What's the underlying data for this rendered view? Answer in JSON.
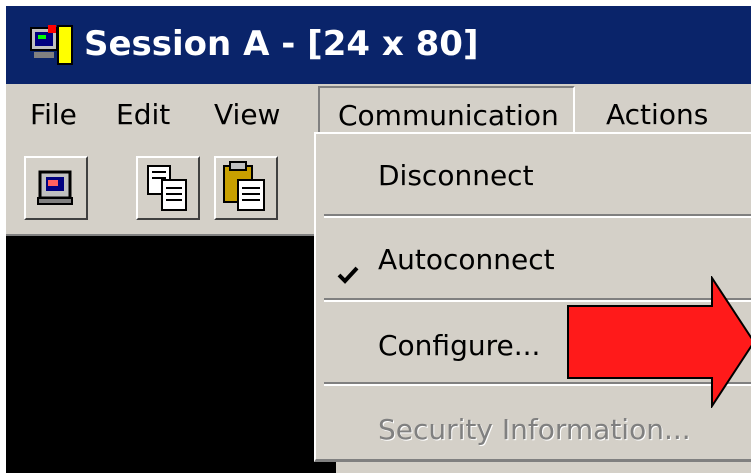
{
  "window": {
    "title": "Session A - [24 x 80]"
  },
  "menubar": {
    "items": [
      {
        "label": "File"
      },
      {
        "label": "Edit"
      },
      {
        "label": "View"
      },
      {
        "label": "Communication",
        "open": true
      },
      {
        "label": "Actions"
      }
    ]
  },
  "toolbar": {
    "buttons": [
      {
        "icon": "session-icon"
      },
      {
        "icon": "copy-icon"
      },
      {
        "icon": "paste-icon"
      }
    ]
  },
  "dropdown": {
    "items": [
      {
        "label": "Disconnect",
        "enabled": true,
        "checked": false
      },
      {
        "label": "Autoconnect",
        "enabled": true,
        "checked": true
      },
      {
        "label": "Configure...",
        "enabled": true,
        "checked": false
      },
      {
        "label": "Security Information...",
        "enabled": false,
        "checked": false
      }
    ]
  },
  "annotation": {
    "shape": "arrow-right",
    "color": "#ff1a1a"
  },
  "colors": {
    "titlebar": "#0a246a",
    "chrome": "#d4d0c8",
    "terminal": "#000000"
  }
}
